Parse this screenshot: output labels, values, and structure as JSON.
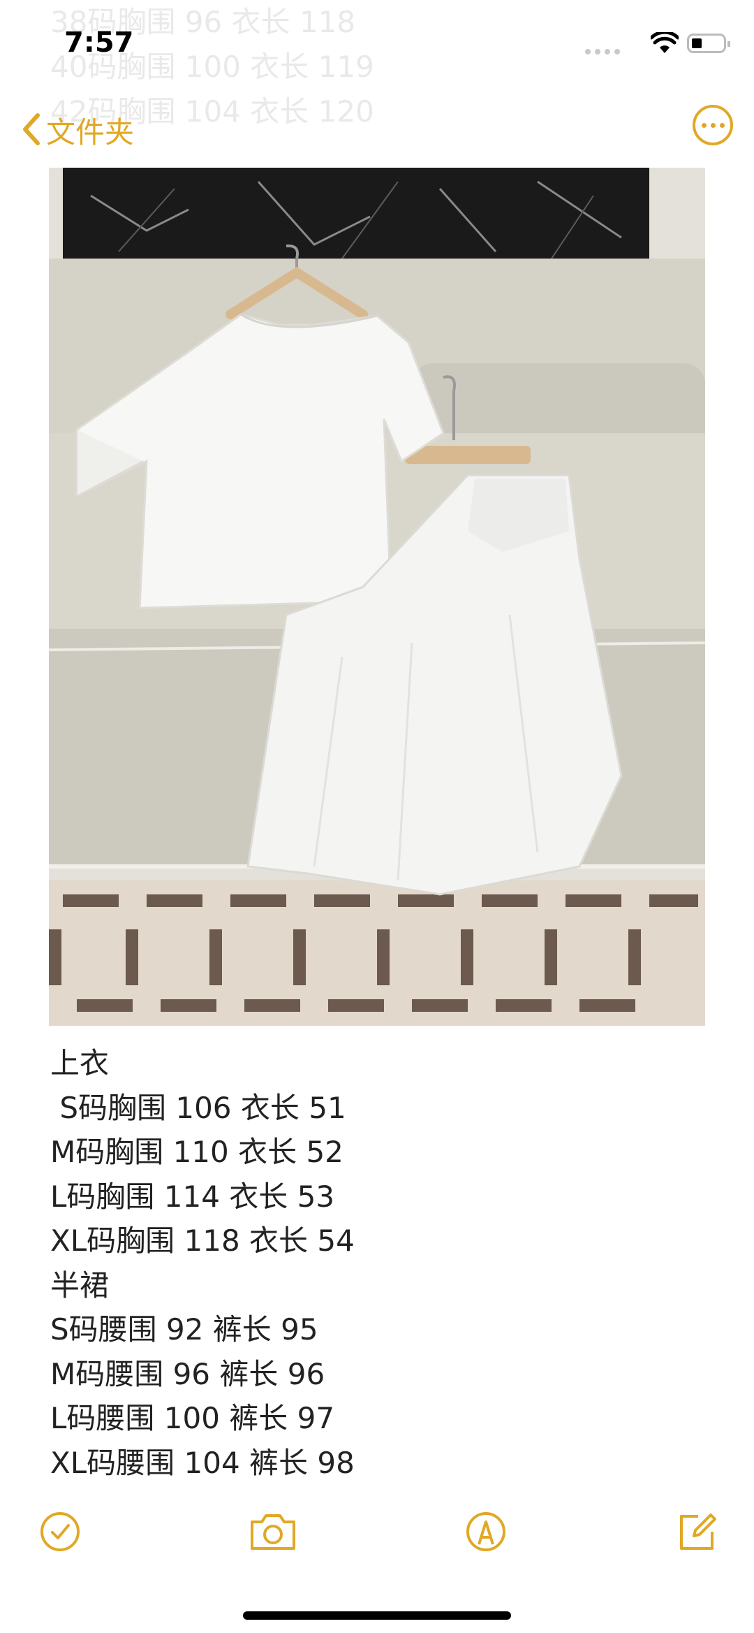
{
  "status_bar": {
    "time": "7:57"
  },
  "background_ghost_text": [
    "38码胸围 96 衣长 118",
    "40码胸围 100 衣长 119",
    "42码胸围 104 衣长 120"
  ],
  "nav": {
    "back_label": "文件夹",
    "back_icon": "chevron-left-icon",
    "more_icon": "ellipsis-circle-icon"
  },
  "note": {
    "lines": [
      "上衣",
      " S码胸围 106 衣长 51",
      "M码胸围 110 衣长 52",
      "L码胸围 114 衣长 53",
      "XL码胸围 118 衣长 54",
      "半裙",
      "S码腰围 92 裤长 95",
      "M码腰围 96 裤长 96",
      "L码腰围 100 裤长 97",
      "XL码腰围 104 裤长 98"
    ]
  },
  "toolbar": {
    "items": [
      "checklist-icon",
      "camera-icon",
      "markup-icon",
      "compose-icon"
    ]
  },
  "colors": {
    "accent": "#e1a825",
    "text": "#222222"
  }
}
